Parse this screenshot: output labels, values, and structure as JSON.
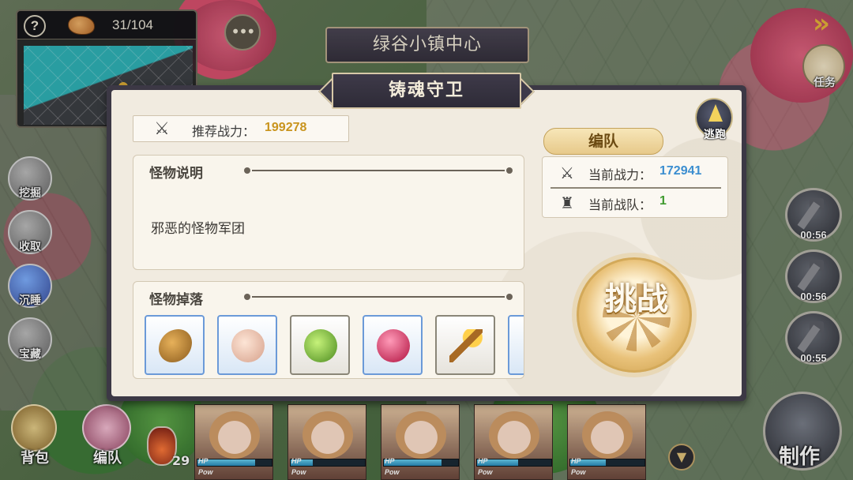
{
  "hud": {
    "bread_count": "31/104",
    "help_label": "?",
    "location": "绿谷小镇中心",
    "task_label": "任务",
    "chat_glyph": "•••"
  },
  "left_actions": [
    {
      "label": "挖掘",
      "icon": "shovel-icon"
    },
    {
      "label": "收取",
      "icon": "hand-icon"
    },
    {
      "label": "沉睡",
      "icon": "mushroom-icon"
    },
    {
      "label": "宝藏",
      "icon": "treasure-map-icon"
    }
  ],
  "timers": [
    {
      "time": "00:56",
      "icon": "hammer-icon"
    },
    {
      "time": "00:56",
      "icon": "hammer-icon"
    },
    {
      "time": "00:55",
      "icon": "hammer-icon"
    }
  ],
  "bottom": {
    "bag_label": "背包",
    "team_label": "编队",
    "potion_count": "29",
    "craft_label": "制作",
    "heroes": [
      {
        "hp": 0.78,
        "hp_label": "HP",
        "pow_label": "Pow"
      },
      {
        "hp": 0.3,
        "hp_label": "HP",
        "pow_label": "Pow"
      },
      {
        "hp": 0.78,
        "hp_label": "HP",
        "pow_label": "Pow"
      },
      {
        "hp": 0.55,
        "hp_label": "HP",
        "pow_label": "Pow"
      },
      {
        "hp": 0.48,
        "hp_label": "HP",
        "pow_label": "Pow"
      }
    ]
  },
  "modal": {
    "title": "铸魂守卫",
    "close_label": "逃跑",
    "recommended_label": "推荐战力：",
    "recommended_value": "199278",
    "desc_title": "怪物说明",
    "desc_text": "邪恶的怪物军团",
    "drops_title": "怪物掉落",
    "drops": [
      {
        "name": "seed-item",
        "color": "#c48a2e",
        "frame": "blue"
      },
      {
        "name": "roast-chicken-item",
        "color": "#f1c9b5",
        "frame": "blue"
      },
      {
        "name": "green-potion-item",
        "color": "#7cc63a",
        "frame": "grey"
      },
      {
        "name": "red-orb-item",
        "color": "#d8245c",
        "frame": "blue"
      },
      {
        "name": "torch-item",
        "color": "#e3a13a",
        "frame": "grey"
      }
    ],
    "formation_label": "编队",
    "current_power_label": "当前战力：",
    "current_power_value": "172941",
    "current_team_label": "当前战队：",
    "current_team_value": "1",
    "challenge_label": "挑战"
  },
  "colors": {
    "recommended_value": "#c9941d",
    "current_power_value": "#3b8ed0",
    "current_team_value": "#3f9a2f"
  }
}
